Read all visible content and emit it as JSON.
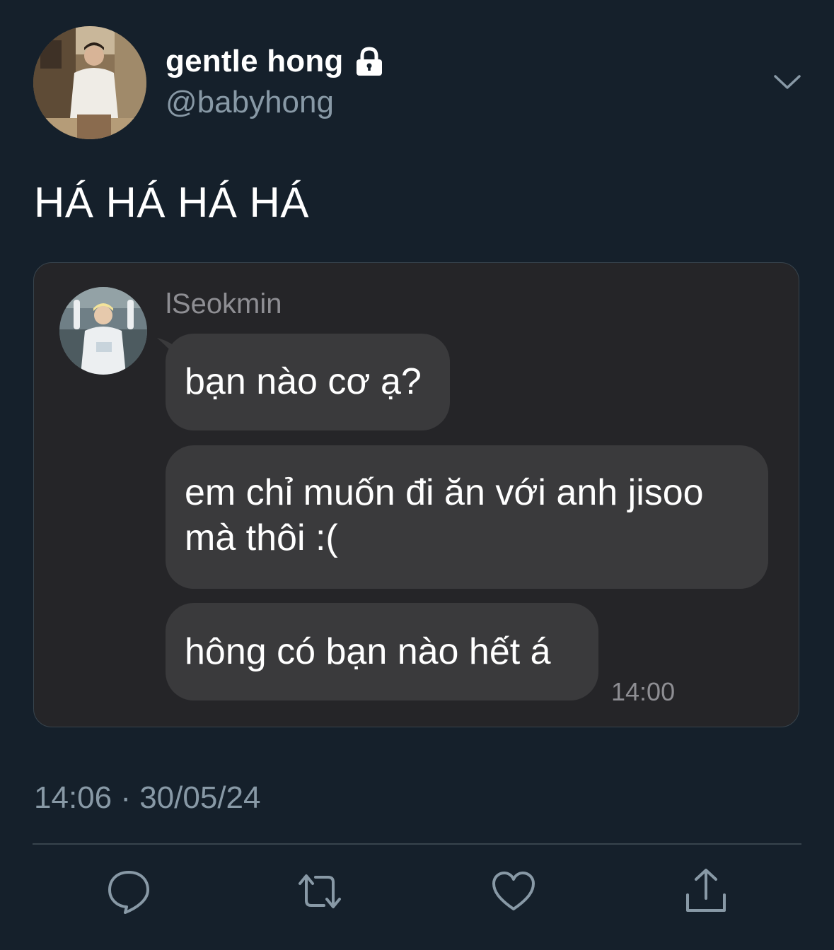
{
  "tweet": {
    "author": {
      "display_name": "gentle hong",
      "handle": "@babyhong",
      "protected_icon": "lock-icon",
      "avatar": "profile-photo"
    },
    "menu_icon": "chevron-down-icon",
    "text": "HÁ HÁ HÁ HÁ",
    "timestamp": "14:06 · 30/05/24",
    "actions": [
      {
        "icon": "reply-icon"
      },
      {
        "icon": "retweet-icon"
      },
      {
        "icon": "like-icon"
      },
      {
        "icon": "share-icon"
      }
    ]
  },
  "chat": {
    "sender": "lSeokmin",
    "messages": [
      {
        "text": "bạn nào cơ ạ?"
      },
      {
        "text": "em chỉ muốn đi ăn với anh jisoo mà thôi :("
      },
      {
        "text": "hông có bạn nào hết á"
      }
    ],
    "time": "14:00"
  },
  "colors": {
    "background": "#15202b",
    "secondary_text": "#8899a6",
    "card_background": "#252528",
    "bubble": "#3a3a3c"
  }
}
